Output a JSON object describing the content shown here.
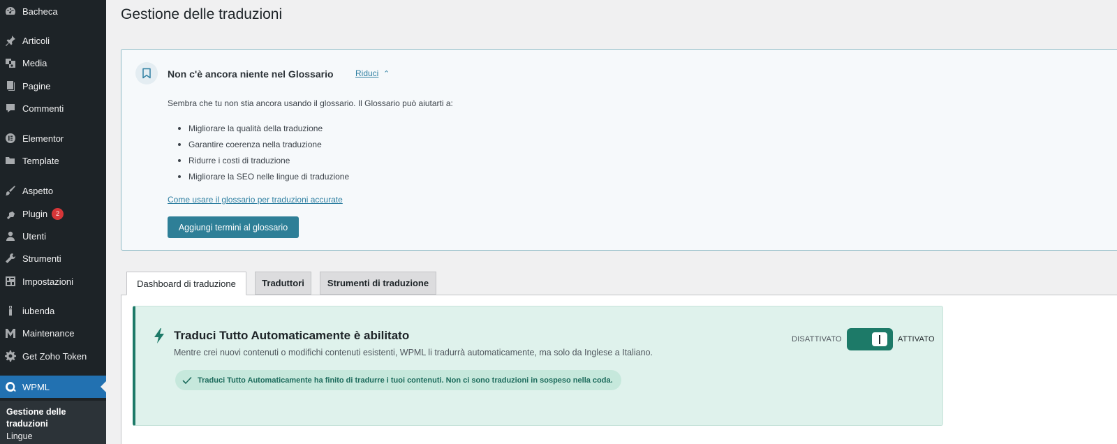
{
  "sidebar": {
    "items": [
      {
        "label": "Bacheca",
        "icon": "dashboard-icon"
      },
      {
        "label": "Articoli",
        "icon": "pin-icon"
      },
      {
        "label": "Media",
        "icon": "media-icon"
      },
      {
        "label": "Pagine",
        "icon": "pages-icon"
      },
      {
        "label": "Commenti",
        "icon": "comments-icon"
      },
      {
        "label": "Elementor",
        "icon": "elementor-icon"
      },
      {
        "label": "Template",
        "icon": "folder-icon"
      },
      {
        "label": "Aspetto",
        "icon": "brush-icon"
      },
      {
        "label": "Plugin",
        "icon": "plugin-icon",
        "badge": "2"
      },
      {
        "label": "Utenti",
        "icon": "user-icon"
      },
      {
        "label": "Strumenti",
        "icon": "wrench-icon"
      },
      {
        "label": "Impostazioni",
        "icon": "settings-icon"
      },
      {
        "label": "iubenda",
        "icon": "iubenda-icon"
      },
      {
        "label": "Maintenance",
        "icon": "maintenance-icon"
      },
      {
        "label": "Get Zoho Token",
        "icon": "gear-icon"
      },
      {
        "label": "WPML",
        "icon": "wpml-icon",
        "active": true
      }
    ],
    "submenu": {
      "current": "Gestione delle traduzioni",
      "next": "Lingue"
    }
  },
  "page": {
    "title": "Gestione delle traduzioni"
  },
  "glossary": {
    "icon": "bookmark-icon",
    "title": "Non c'è ancora niente nel Glossario",
    "collapse_label": "Riduci",
    "collapse_icon": "chevron-up-icon",
    "intro": "Sembra che tu non stia ancora usando il glossario. Il Glossario può aiutarti a:",
    "benefits": [
      "Migliorare la qualità della traduzione",
      "Garantire coerenza nella traduzione",
      "Ridurre i costi di traduzione",
      "Migliorare la SEO nelle lingue di traduzione"
    ],
    "link": "Come usare il glossario per traduzioni accurate",
    "button": "Aggiungi termini al glossario"
  },
  "tabs": [
    {
      "label": "Dashboard di traduzione",
      "active": true
    },
    {
      "label": "Traduttori",
      "active": false
    },
    {
      "label": "Strumenti di traduzione",
      "active": false
    }
  ],
  "auto_translate": {
    "icon": "bolt-icon",
    "title": "Traduci Tutto Automaticamente è abilitato",
    "description": "Mentre crei nuovi contenuti o modifichi contenuti esistenti, WPML li tradurrà automaticamente, ma solo da Inglese a Italiano.",
    "toggle_off_label": "DISATTIVATO",
    "toggle_on_label": "ATTIVATO",
    "toggle_state": "on",
    "status_icon": "checkmark-icon",
    "status": "Traduci Tutto Automaticamente ha finito di tradurre i tuoi contenuti. Non ci sono traduzioni in sospeso nella coda."
  },
  "colors": {
    "sidebar_bg": "#1d2327",
    "sidebar_active": "#2271b1",
    "badge": "#d63638",
    "glossary_button": "#2e7f97",
    "link": "#2e7fa1",
    "toggle_on": "#1d7a68",
    "auto_box_bg": "#dff2ec"
  }
}
